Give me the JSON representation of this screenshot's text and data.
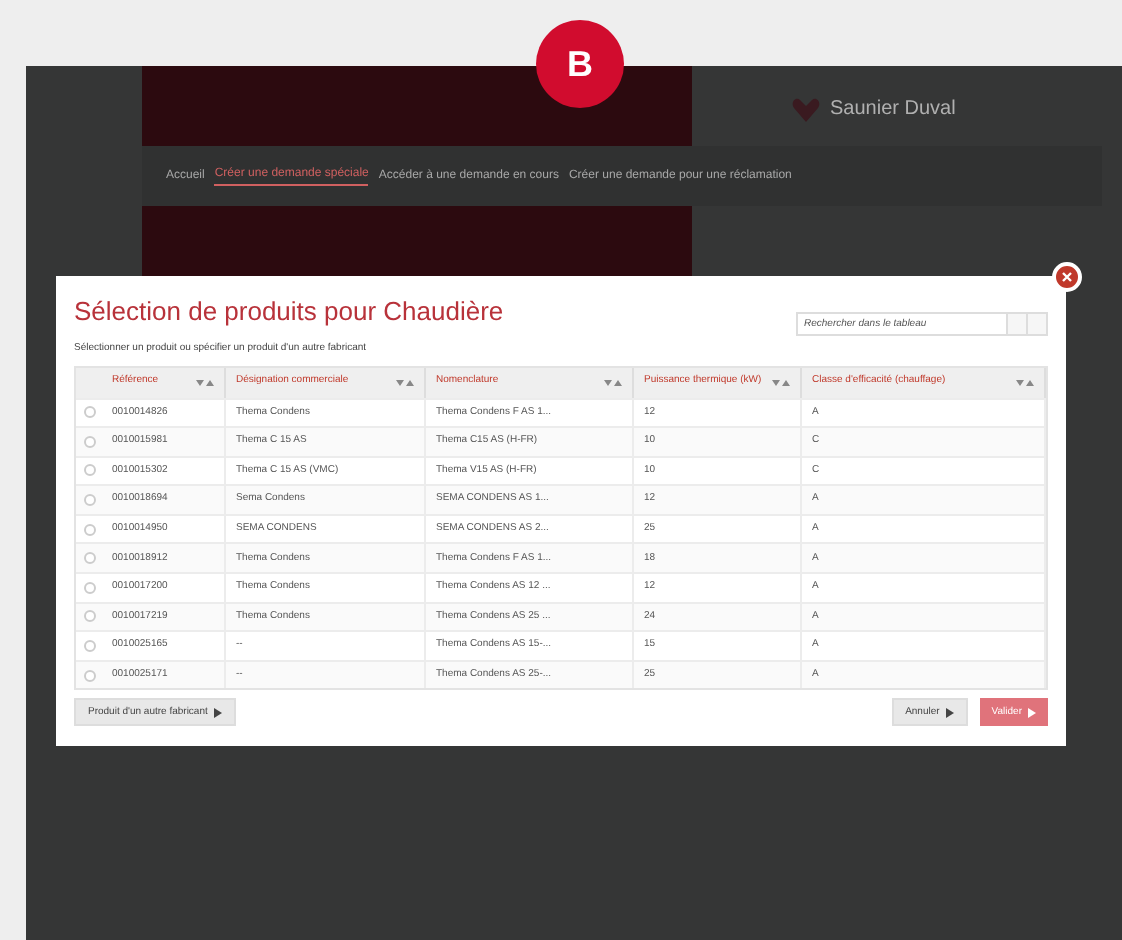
{
  "badge": "B",
  "background_page": {
    "logo": "Saunier Duval",
    "nav": [
      {
        "label": "Accueil",
        "selected": false
      },
      {
        "label": "Créer une demande spéciale",
        "selected": true
      },
      {
        "label": "Accéder à une demande en cours",
        "selected": false
      },
      {
        "label": "Créer une demande pour une réclamation",
        "selected": false
      }
    ]
  },
  "dialog": {
    "title": "Sélection de produits pour Chaudière",
    "subtitle": "Sélectionner un produit ou spécifier un produit d'un autre fabricant",
    "search": {
      "placeholder": "Rechercher dans le tableau"
    },
    "table": {
      "columns": [
        "Référence",
        "Désignation commerciale",
        "Nomenclature",
        "Puissance thermique (kW)",
        "Classe d'efficacité (chauffage)"
      ],
      "rows": [
        {
          "checked": false,
          "cells": [
            "0010014826",
            "Thema Condens",
            "Thema Condens F AS 1...",
            "12",
            "A"
          ]
        },
        {
          "checked": false,
          "cells": [
            "0010015981",
            "Thema C 15 AS",
            "Thema C15 AS (H-FR)",
            "10",
            "C"
          ]
        },
        {
          "checked": false,
          "cells": [
            "0010015302",
            "Thema C 15 AS (VMC)",
            "Thema V15 AS (H-FR)",
            "10",
            "C"
          ]
        },
        {
          "checked": false,
          "cells": [
            "0010018694",
            "Sema Condens",
            "SEMA CONDENS AS 1...",
            "12",
            "A"
          ]
        },
        {
          "checked": false,
          "cells": [
            "0010014950",
            "SEMA CONDENS",
            "SEMA CONDENS AS 2...",
            "25",
            "A"
          ]
        },
        {
          "checked": false,
          "cells": [
            "0010018912",
            "Thema Condens",
            "Thema Condens F AS 1...",
            "18",
            "A"
          ]
        },
        {
          "checked": false,
          "cells": [
            "0010017200",
            "Thema Condens",
            "Thema Condens AS 12 ...",
            "12",
            "A"
          ]
        },
        {
          "checked": false,
          "cells": [
            "0010017219",
            "Thema Condens",
            "Thema Condens AS 25 ...",
            "24",
            "A"
          ]
        },
        {
          "checked": false,
          "cells": [
            "0010025165",
            "--",
            "Thema Condens AS 15-...",
            "15",
            "A"
          ]
        },
        {
          "checked": false,
          "cells": [
            "0010025171",
            "--",
            "Thema Condens AS 25-...",
            "25",
            "A"
          ]
        }
      ]
    },
    "buttons": [
      {
        "label": "Produit d'un autre fabricant",
        "kind": "secondary"
      },
      {
        "label": "Annuler",
        "kind": "secondary"
      },
      {
        "label": "Valider",
        "kind": "primary"
      }
    ]
  }
}
